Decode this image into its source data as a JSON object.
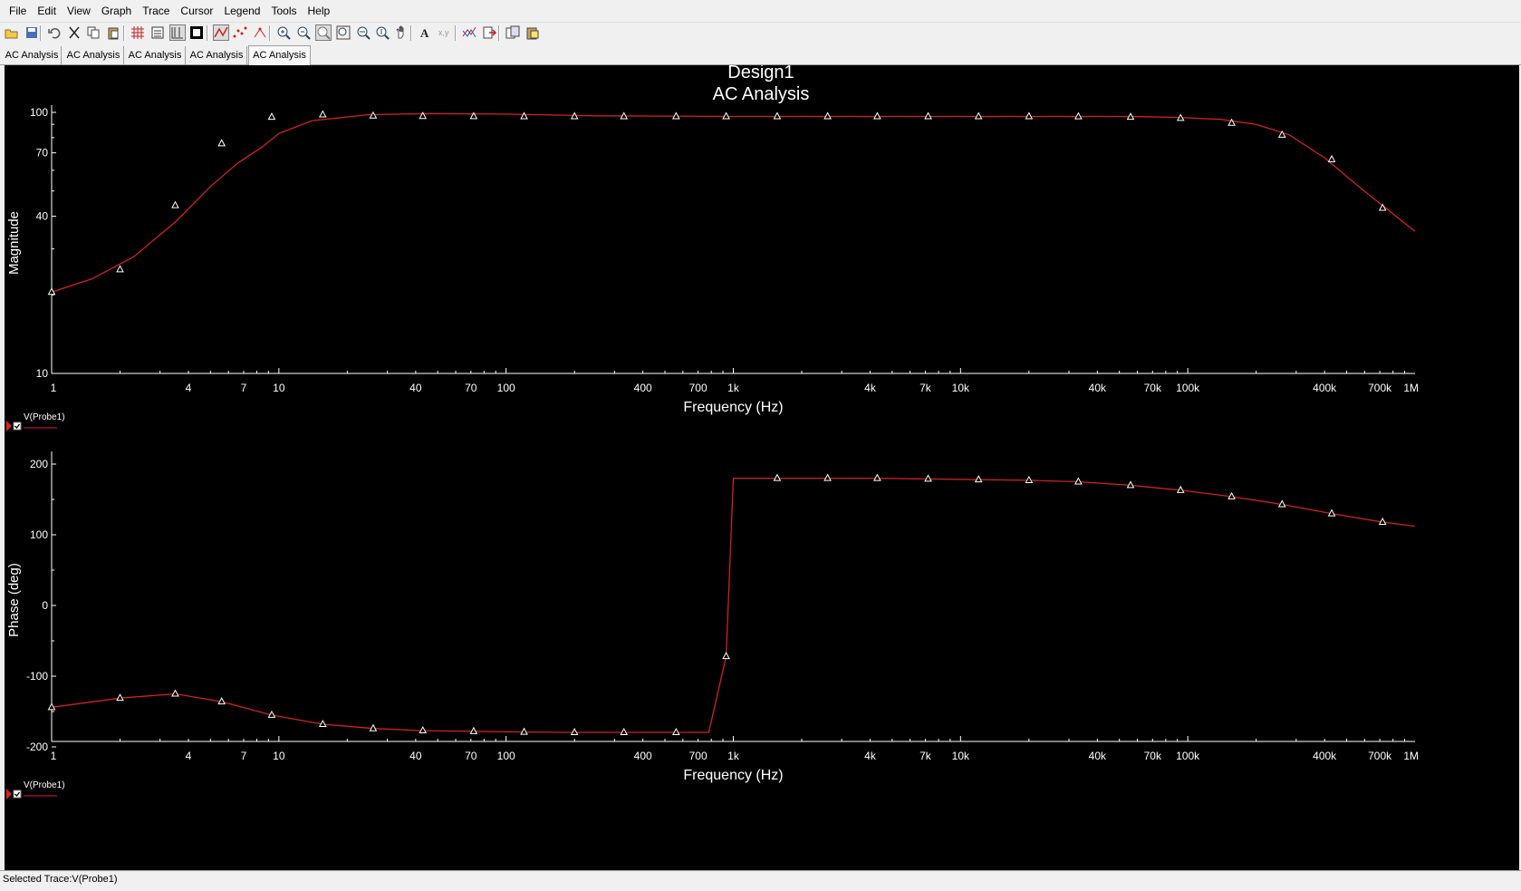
{
  "menu": [
    "File",
    "Edit",
    "View",
    "Graph",
    "Trace",
    "Cursor",
    "Legend",
    "Tools",
    "Help"
  ],
  "toolbar": {
    "buttons": [
      "open-icon",
      "save-icon",
      "undo-icon",
      "cut-icon",
      "copy-icon",
      "paste-icon",
      "grid-icon",
      "legend-icon",
      "show-cursors-icon",
      "reverse-colors-icon",
      "trace-line-icon",
      "trace-markers-icon",
      "trace-line-markers-icon",
      "zoom-in-icon",
      "zoom-out-icon",
      "zoom-area-icon",
      "zoom-full-icon",
      "zoom-x-icon",
      "zoom-y-icon",
      "pan-icon",
      "text-icon",
      "label-icon",
      "overlay-traces-icon",
      "export-icon",
      "copy-graph-icon",
      "paste-graph-icon"
    ]
  },
  "tabs": [
    "AC Analysis",
    "AC Analysis",
    "AC Analysis",
    "AC Analysis",
    "AC Analysis"
  ],
  "active_tab": 4,
  "graph": {
    "title": "Design1",
    "subtitle": "AC Analysis",
    "background": "#000000",
    "axis_color": "#ffffff",
    "trace_color": "#d42020"
  },
  "chart_data": [
    {
      "type": "line",
      "title": "Design1 AC Analysis",
      "xlabel": "Frequency (Hz)",
      "ylabel": "Magnitude",
      "xscale": "log",
      "yscale": "log",
      "xlim": [
        1,
        1000000
      ],
      "ylim": [
        10,
        100
      ],
      "x_tick_labels": [
        "1",
        "4",
        "7",
        "10",
        "40",
        "70",
        "100",
        "400",
        "700",
        "1k",
        "4k",
        "7k",
        "10k",
        "40k",
        "70k",
        "100k",
        "400k",
        "700k",
        "1M"
      ],
      "x_ticks": [
        1,
        4,
        7,
        10,
        40,
        70,
        100,
        400,
        700,
        1000,
        4000,
        7000,
        10000,
        40000,
        70000,
        100000,
        400000,
        700000,
        1000000
      ],
      "y_tick_labels": [
        "100",
        "70",
        "40",
        "10"
      ],
      "y_ticks": [
        100,
        70,
        40,
        10
      ],
      "legend": "bottom-left",
      "series": [
        {
          "name": "V(Probe1)",
          "x": [
            1,
            1.5,
            2.3,
            3.5,
            5,
            6.6,
            8.5,
            10,
            14,
            25,
            45,
            100,
            250,
            1000,
            5000,
            15000,
            30000,
            48000,
            62000,
            90000,
            140000,
            200000,
            280000,
            400000,
            550000,
            1000000
          ],
          "y": [
            20.5,
            23,
            28,
            38,
            52,
            64,
            74,
            83,
            93,
            98,
            99,
            98.5,
            97,
            96.5,
            96.5,
            96.5,
            96.5,
            96.5,
            96.3,
            95.7,
            94,
            90,
            82,
            67,
            53,
            35
          ],
          "marker_x": [
            1,
            2,
            3.5,
            5.6,
            9.3,
            15.6,
            26,
            43,
            72,
            120,
            200,
            330,
            560,
            930,
            1560,
            2600,
            4300,
            7200,
            12000,
            20000,
            33000,
            56000,
            93000,
            156000,
            260000,
            430000,
            720000
          ],
          "marker_y": [
            20.5,
            25,
            44,
            76,
            96,
            98,
            97,
            96.7,
            96.6,
            96.5,
            96.5,
            96.5,
            96.5,
            96.5,
            96.5,
            96.5,
            96.5,
            96.5,
            96.5,
            96.5,
            96.4,
            96,
            95,
            91,
            82,
            66,
            43
          ]
        }
      ]
    },
    {
      "type": "line",
      "title": "",
      "xlabel": "Frequency (Hz)",
      "ylabel": "Phase (deg)",
      "xscale": "log",
      "xlim": [
        1,
        1000000
      ],
      "ylim": [
        -200,
        200
      ],
      "x_tick_labels": [
        "1",
        "4",
        "7",
        "10",
        "40",
        "70",
        "100",
        "400",
        "700",
        "1k",
        "4k",
        "7k",
        "10k",
        "40k",
        "70k",
        "100k",
        "400k",
        "700k",
        "1M"
      ],
      "x_ticks": [
        1,
        4,
        7,
        10,
        40,
        70,
        100,
        400,
        700,
        1000,
        4000,
        7000,
        10000,
        40000,
        70000,
        100000,
        400000,
        700000,
        1000000
      ],
      "y_tick_labels": [
        "200",
        "100",
        "0",
        "-100",
        "-200"
      ],
      "y_ticks": [
        200,
        100,
        0,
        -100,
        -200
      ],
      "legend": "bottom-left",
      "series": [
        {
          "name": "V(Probe1)",
          "x": [
            1,
            2,
            3.5,
            5.6,
            9.3,
            15.6,
            26,
            43,
            72,
            120,
            200,
            330,
            560,
            780,
            930,
            1000,
            1560,
            2600,
            4300,
            7200,
            12000,
            20000,
            33000,
            56000,
            93000,
            156000,
            260000,
            430000,
            720000,
            1000000
          ],
          "y": [
            -144,
            -131,
            -125,
            -136,
            -155,
            -168,
            -174,
            -177,
            -178,
            -179,
            -179.5,
            -179.5,
            -179.5,
            -179.5,
            -72,
            180,
            180,
            180,
            180,
            179,
            178,
            177,
            175,
            170,
            163,
            154,
            143,
            130,
            118,
            112
          ],
          "marker_x": [
            1,
            2,
            3.5,
            5.6,
            9.3,
            15.6,
            26,
            43,
            72,
            120,
            200,
            330,
            560,
            930,
            1560,
            2600,
            4300,
            7200,
            12000,
            20000,
            33000,
            56000,
            93000,
            156000,
            260000,
            430000,
            720000
          ],
          "marker_y": [
            -144,
            -131,
            -125,
            -136,
            -155,
            -168,
            -174,
            -177,
            -178,
            -179,
            -179.5,
            -179.5,
            -179.5,
            -72,
            180,
            180,
            180,
            179,
            178,
            177,
            175,
            170,
            163,
            154,
            143,
            130,
            118
          ]
        }
      ]
    }
  ],
  "status": "Selected Trace:V(Probe1)"
}
